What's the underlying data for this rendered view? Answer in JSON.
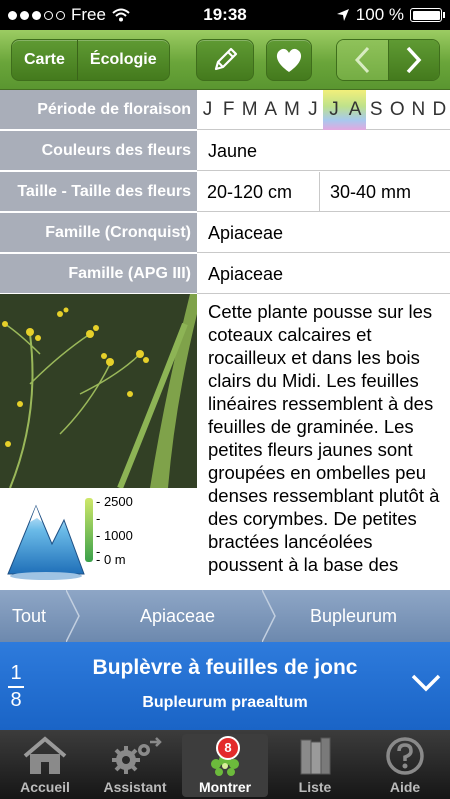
{
  "status_bar": {
    "carrier": "Free",
    "time": "19:38",
    "battery": "100 %",
    "battery_level": 1.0
  },
  "toolbar": {
    "segments": [
      "Carte",
      "Écologie"
    ],
    "edit_icon": "pencil-icon",
    "favorite_icon": "heart-icon",
    "prev_icon": "chevron-left-icon",
    "next_icon": "chevron-right-icon"
  },
  "info": {
    "flowering": {
      "label": "Période de floraison",
      "months": [
        "J",
        "F",
        "M",
        "A",
        "M",
        "J",
        "J",
        "A",
        "S",
        "O",
        "N",
        "D"
      ],
      "highlighted_months": [
        "J",
        "A"
      ]
    },
    "flower_color": {
      "label": "Couleurs des fleurs",
      "value": "Jaune"
    },
    "size": {
      "label": "Taille - Taille des fleurs",
      "plant": "20-120 cm",
      "flower": "30-40 mm"
    },
    "family_cronquist": {
      "label": "Famille (Cronquist)",
      "value": "Apiaceae"
    },
    "family_apg": {
      "label": "Famille (APG III)",
      "value": "Apiaceae"
    }
  },
  "altitude": {
    "top": "- 2500",
    "mid1": "-",
    "mid2": "- 1000",
    "mid3": "-",
    "bottom": "- 0 m"
  },
  "description": "Cette plante pousse sur les coteaux calcaires et rocailleux et dans les bois clairs du Midi.  Les feuilles linéaires ressemblent à des feuilles de graminée. Les petites fleurs jaunes sont groupées en ombelles peu denses ressemblant plutôt à des corymbes. De petites bractées lancéolées poussent à la base des",
  "breadcrumb": [
    "Tout",
    "Apiaceae",
    "Bupleurum"
  ],
  "species": {
    "index": "1",
    "total": "8",
    "common_name": "Buplèvre à feuilles de jonc",
    "latin_name": "Bupleurum praealtum"
  },
  "tabs": [
    {
      "label": "Accueil",
      "icon": "home-icon"
    },
    {
      "label": "Assistant",
      "icon": "gears-icon"
    },
    {
      "label": "Montrer",
      "icon": "flower-icon",
      "badge": "8",
      "active": true
    },
    {
      "label": "Liste",
      "icon": "books-icon"
    },
    {
      "label": "Aide",
      "icon": "help-icon"
    }
  ],
  "colors": {
    "toolbar_green": "#6aa53a",
    "label_gray": "#a9aeb9",
    "breadcrumb_blue": "#7f98bb",
    "species_blue": "#1f6bd0",
    "badge_red": "#e32b2b"
  }
}
